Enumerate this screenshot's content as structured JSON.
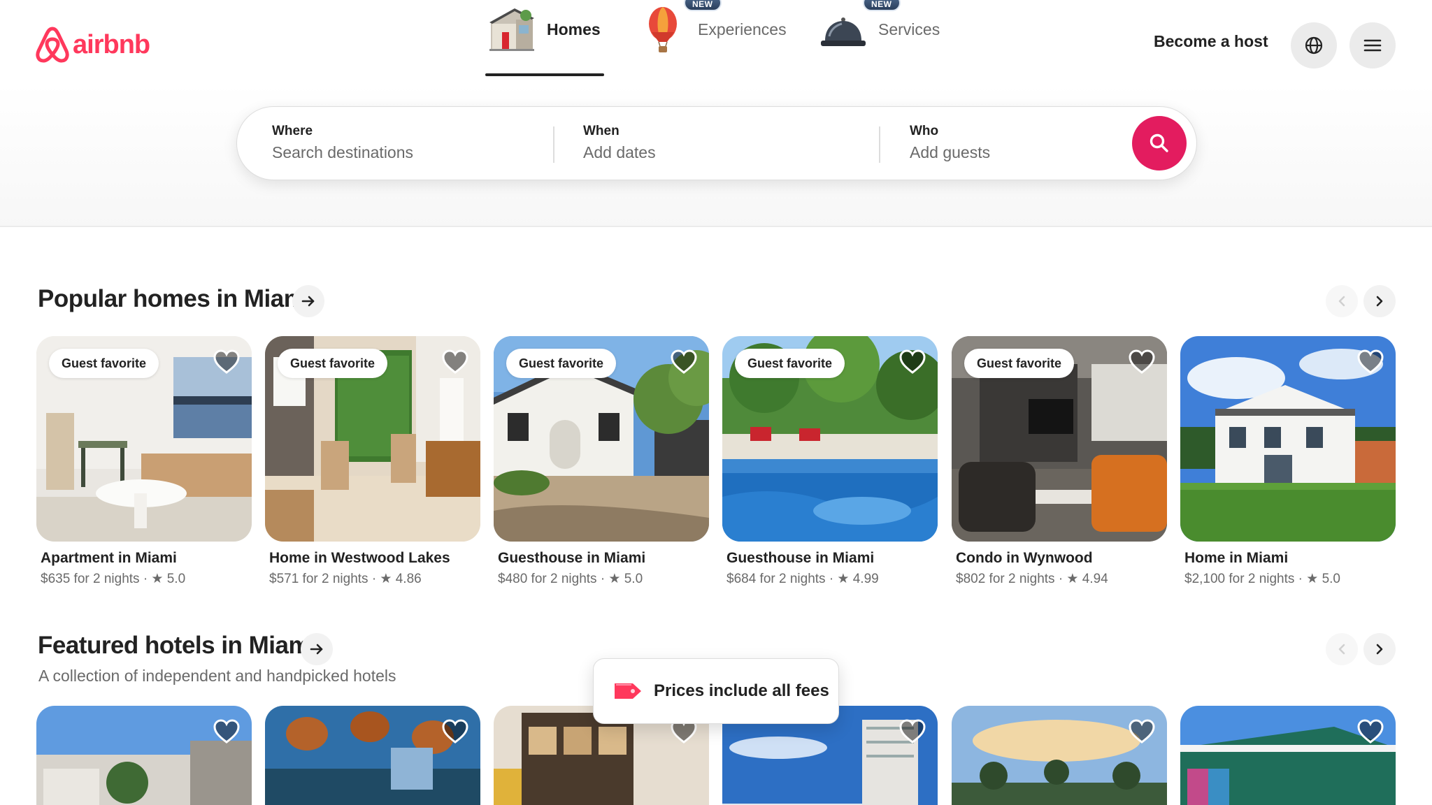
{
  "brand": {
    "name": "airbnb",
    "color": "#ff385c"
  },
  "nav": {
    "tabs": [
      {
        "label": "Homes",
        "icon": "house-icon",
        "active": true
      },
      {
        "label": "Experiences",
        "icon": "hot-air-balloon-icon",
        "badge": "NEW"
      },
      {
        "label": "Services",
        "icon": "service-bell-icon",
        "badge": "NEW"
      }
    ],
    "become_host": "Become a host",
    "globe_icon": "globe-icon",
    "menu_icon": "menu-icon"
  },
  "search": {
    "where": {
      "title": "Where",
      "placeholder": "Search destinations"
    },
    "when": {
      "title": "When",
      "placeholder": "Add dates"
    },
    "who": {
      "title": "Who",
      "placeholder": "Add guests"
    },
    "button_icon": "search-icon",
    "accent": "#e31c5f"
  },
  "popular": {
    "title": "Popular homes in Miami",
    "listings": [
      {
        "badge": "Guest favorite",
        "title": "Apartment in Miami",
        "meta": "$635 for 2 nights · ★ 5.0"
      },
      {
        "badge": "Guest favorite",
        "title": "Home in Westwood Lakes",
        "meta": "$571 for 2 nights · ★ 4.86"
      },
      {
        "badge": "Guest favorite",
        "title": "Guesthouse in Miami",
        "meta": "$480 for 2 nights · ★ 5.0"
      },
      {
        "badge": "Guest favorite",
        "title": "Guesthouse in Miami",
        "meta": "$684 for 2 nights · ★ 4.99"
      },
      {
        "badge": "Guest favorite",
        "title": "Condo in Wynwood",
        "meta": "$802 for 2 nights · ★ 4.94"
      },
      {
        "title": "Home in Miami",
        "meta": "$2,100 for 2 nights · ★ 5.0"
      }
    ]
  },
  "featured": {
    "title": "Featured hotels in Miami",
    "subtitle": "A collection of independent and handpicked hotels"
  },
  "toast": {
    "text": "Prices include all fees",
    "icon": "price-tag-icon"
  }
}
